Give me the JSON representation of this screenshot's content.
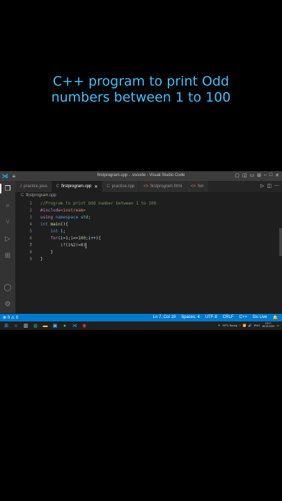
{
  "caption": {
    "line1": "C++ program to print Odd",
    "line2": "numbers between 1 to 100"
  },
  "window": {
    "title": "firstprogram.cpp - .vscode - Visual Studio Code"
  },
  "tabs": [
    {
      "label": "practice.java",
      "icon": "J",
      "color": "#f14c4c"
    },
    {
      "label": "firstprogram.cpp",
      "icon": "C",
      "color": "#519aba",
      "close": "✕"
    },
    {
      "label": "practice.cpp",
      "icon": "C",
      "color": "#519aba"
    },
    {
      "label": "firstprogram.html",
      "icon": "<>",
      "color": "#e37933"
    },
    {
      "label": "fon",
      "icon": "<>",
      "color": "#e37933"
    }
  ],
  "breadcrumb": "firstprogram.cpp",
  "code": {
    "line_numbers": [
      "1",
      "2",
      "3",
      "4",
      "5",
      "6",
      "7",
      "8",
      "9"
    ],
    "l1": "//Program to print Odd number between 1 to 100.",
    "l2a": "#include",
    "l2b": "<iostream>",
    "l3a": "using",
    "l3b": "namespace",
    "l3c": "std",
    "l3d": ";",
    "l4a": "int",
    "l4b": "main",
    "l4c": "(){",
    "l5a": "int",
    "l5b": "i",
    "l5c": ";",
    "l6a": "for",
    "l6b": "(",
    "l6c": "i",
    "l6d": "=",
    "l6e": "1",
    "l6f": ";",
    "l6g": "i",
    "l6h": "<=",
    "l6i": "100",
    "l6j": ";",
    "l6k": "i",
    "l6l": "++",
    "l6m": "){",
    "l7a": "if",
    "l7b": "(",
    "l7c": "i",
    "l7d": "%",
    "l7e": "2",
    "l7f": "!=",
    "l7g": "0",
    "l7h": ")",
    "l8": "}",
    "l9": "}"
  },
  "status": {
    "left": "⊗ 0 ⚠ 0",
    "ln_col": "Ln 7, Col 19",
    "spaces": "Spaces: 4",
    "encoding": "UTF-8",
    "eol": "CRLF",
    "language": "C++",
    "golive": "Go Live"
  },
  "taskbar": {
    "weather": "33°C  Sunny",
    "lang": "ENG",
    "time": "15:17",
    "date": "18-04-2023"
  }
}
